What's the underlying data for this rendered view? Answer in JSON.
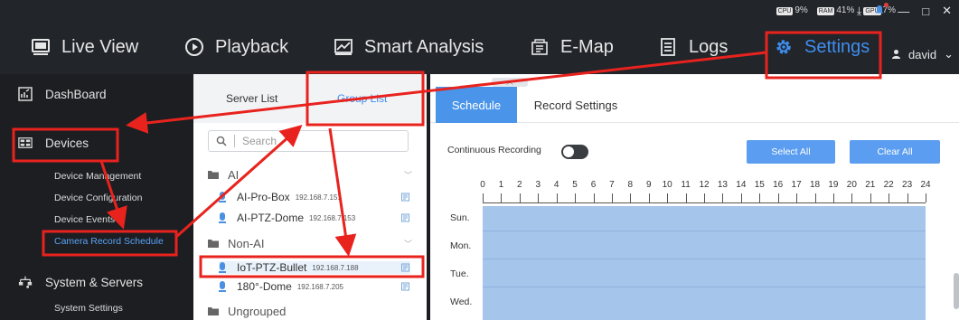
{
  "status": {
    "cpu_chip": "CPU",
    "cpu": "9%",
    "ram_chip": "RAM",
    "ram": "41%",
    "gpu_chip": "GPU",
    "gpu": "7%"
  },
  "window_controls": {
    "download": "⤓",
    "minimize": "—",
    "maximize": "□",
    "close": "✕"
  },
  "nav": {
    "live_view": "Live View",
    "playback": "Playback",
    "smart_analysis": "Smart Analysis",
    "emap": "E-Map",
    "logs": "Logs",
    "settings": "Settings"
  },
  "user": {
    "name": "david",
    "caret": "⌄"
  },
  "sidebar": {
    "dashboard": "DashBoard",
    "devices": "Devices",
    "device_items": [
      "Device Management",
      "Device Configuration",
      "Device Events",
      "Camera Record Schedule"
    ],
    "system_servers": "System & Servers",
    "system_items": [
      "System Settings"
    ]
  },
  "list_panel": {
    "tabs": [
      "Server List",
      "Group List"
    ],
    "search_placeholder": "Search",
    "groups": [
      {
        "name": "AI",
        "devices": [
          {
            "name": "AI-Pro-Box",
            "ip": "192.168.7.151"
          },
          {
            "name": "AI-PTZ-Dome",
            "ip": "192.168.7.153"
          }
        ]
      },
      {
        "name": "Non-AI",
        "devices": [
          {
            "name": "IoT-PTZ-Bullet",
            "ip": "192.168.7.188"
          },
          {
            "name": "180°-Dome",
            "ip": "192.168.7.205"
          }
        ]
      },
      {
        "name": "Ungrouped",
        "devices": []
      }
    ]
  },
  "schedule_panel": {
    "tabs": [
      "Schedule",
      "Record Settings"
    ],
    "continuous_recording": "Continuous Recording",
    "continuous_recording_on": false,
    "select_all": "Select All",
    "clear_all": "Clear All",
    "hours": [
      "0",
      "1",
      "2",
      "3",
      "4",
      "5",
      "6",
      "7",
      "8",
      "9",
      "10",
      "11",
      "12",
      "13",
      "14",
      "15",
      "16",
      "17",
      "18",
      "19",
      "20",
      "21",
      "22",
      "23",
      "24"
    ],
    "days": [
      "Sun.",
      "Mon.",
      "Tue.",
      "Wed."
    ]
  },
  "colors": {
    "accent": "#3e8ef0",
    "annotation": "#e8231e",
    "schedule_fill": "#a5c5ea"
  }
}
